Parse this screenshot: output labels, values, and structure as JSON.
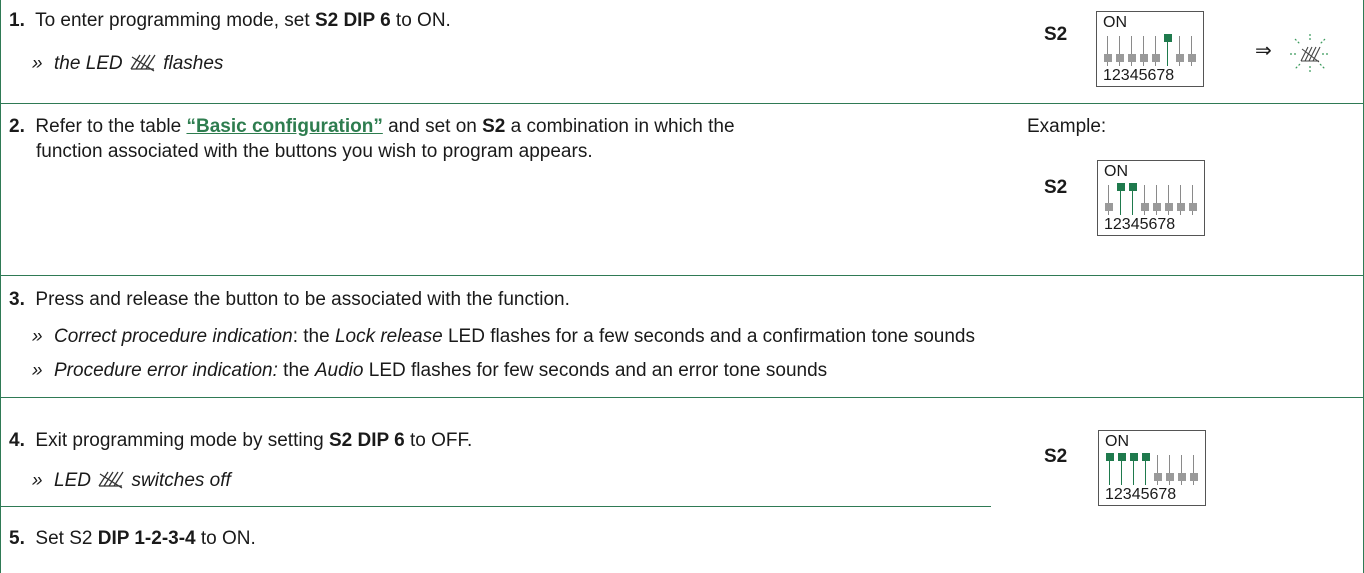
{
  "steps": [
    {
      "num": "1.",
      "line1_pre": "To enter programming mode, set ",
      "line1_bold": "S2 DIP 6",
      "line1_post": " to ON.",
      "sub_pre": "the LED",
      "sub_post": "flashes"
    },
    {
      "num": "2.",
      "line1_pre": "Refer to the table ",
      "link": "“Basic configuration”",
      "line1_mid": " and set on ",
      "line1_bold": "S2",
      "line1_post": " a combination in which the",
      "line2": "function associated with the buttons you wish to program appears."
    },
    {
      "num": "3.",
      "line1": "Press and release the button to be associated with the function.",
      "sub1_it": "Correct procedure indication",
      "sub1_pre": ": the ",
      "sub1_it2": "Lock release",
      "sub1_post": " LED flashes for a few seconds and a confirmation tone sounds",
      "sub2_it": "Procedure error indication:",
      "sub2_pre": " the ",
      "sub2_it2": "Audio",
      "sub2_post": " LED flashes for few seconds and an error tone sounds"
    },
    {
      "num": "4.",
      "line1_pre": "Exit programming mode by setting ",
      "line1_bold": "S2 DIP 6",
      "line1_post": " to OFF.",
      "sub_pre": "LED",
      "sub_post": "switches off"
    },
    {
      "num": "5.",
      "line1_pre": "Set S2 ",
      "line1_bold": "DIP 1-2-3-4",
      "line1_post": " to ON."
    }
  ],
  "bullet": "»",
  "example_label": "Example:",
  "s2": "S2",
  "on": "ON",
  "dip_numbers": "12345678",
  "arrow": "⇒",
  "dip_states": {
    "diagram1": [
      0,
      0,
      0,
      0,
      0,
      1,
      0,
      0
    ],
    "diagram2": [
      0,
      1,
      1,
      0,
      0,
      0,
      0,
      0
    ],
    "diagram3": [
      1,
      1,
      1,
      1,
      0,
      0,
      0,
      0
    ]
  },
  "colors": {
    "accent": "#1f7a4d",
    "switch_off": "#9a9a9a",
    "border": "#2f7a55"
  }
}
